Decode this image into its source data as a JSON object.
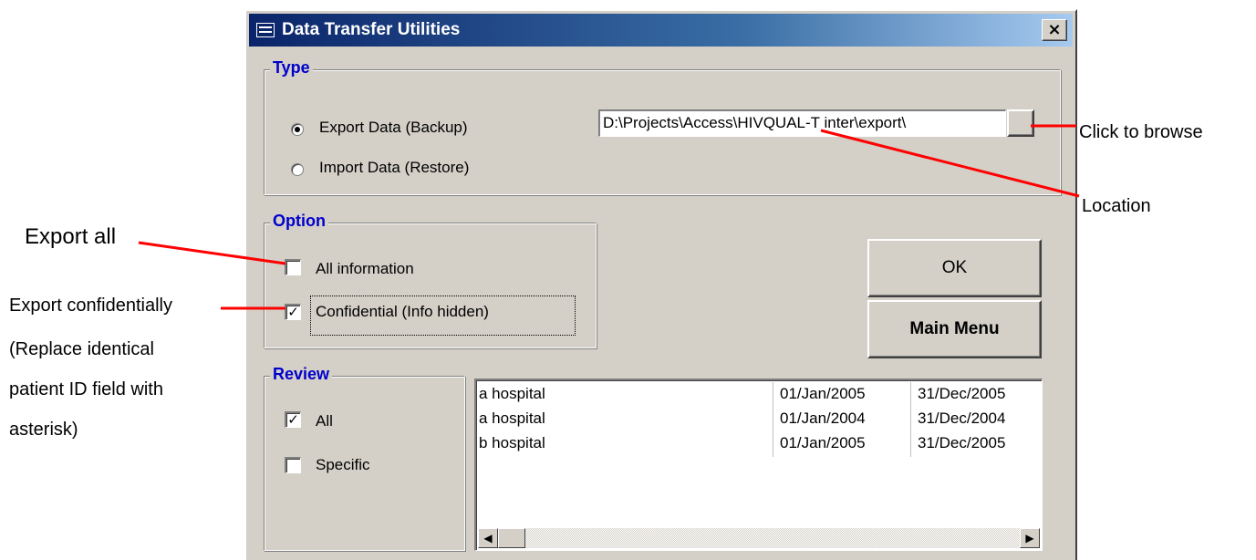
{
  "window": {
    "title": "Data Transfer Utilities",
    "close_label": "×"
  },
  "type_group": {
    "label": "Type",
    "export_label": "Export Data (Backup)",
    "import_label": "Import Data (Restore)",
    "selected": "export",
    "path_value": "D:\\Projects\\Access\\HIVQUAL-T inter\\export\\"
  },
  "option_group": {
    "label": "Option",
    "all_info_label": "All information",
    "all_info_checked": false,
    "confidential_label": "Confidential (Info hidden)",
    "confidential_checked": true
  },
  "buttons": {
    "ok": "OK",
    "main_menu": "Main Menu"
  },
  "review_group": {
    "label": "Review",
    "all_label": "All",
    "all_checked": true,
    "specific_label": "Specific",
    "specific_checked": false
  },
  "review_list": {
    "rows": [
      {
        "name": "a hospital",
        "start": "01/Jan/2005",
        "end": "31/Dec/2005"
      },
      {
        "name": "a hospital",
        "start": "01/Jan/2004",
        "end": "31/Dec/2004"
      },
      {
        "name": "b hospital",
        "start": "01/Jan/2005",
        "end": "31/Dec/2005"
      }
    ]
  },
  "annotations": {
    "browse": "Click to browse",
    "location": "Location",
    "export_all": "Export all",
    "confidential_1": "Export confidentially",
    "confidential_2": "(Replace identical",
    "confidential_3": "patient ID field with",
    "confidential_4": "asterisk)"
  },
  "colors": {
    "dialog_bg": "#d4d0c8",
    "title_start": "#0a246a",
    "title_end": "#a6caf0",
    "group_label": "#0000cc",
    "annotation_line": "#ff0000"
  }
}
